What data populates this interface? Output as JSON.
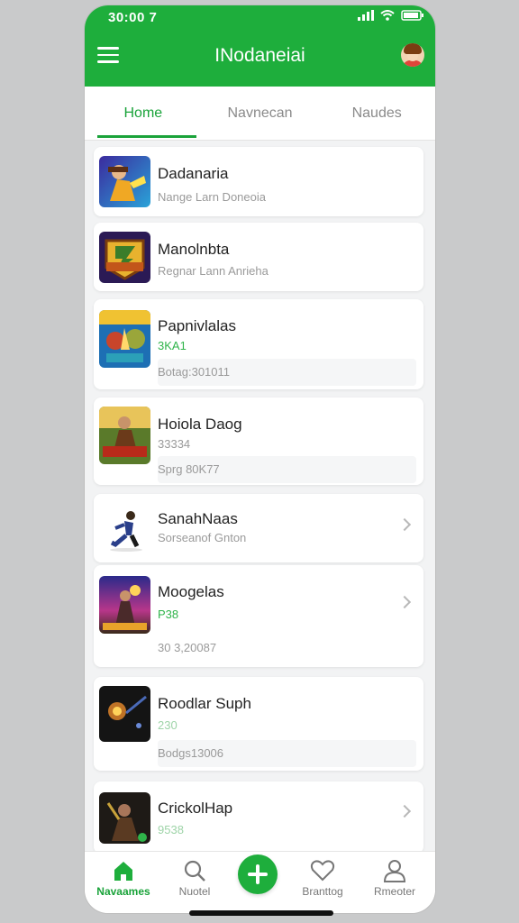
{
  "status_bar": {
    "time": "30:00 7"
  },
  "header": {
    "title": "INodaneiai"
  },
  "tabs": [
    {
      "label": "Home",
      "active": true
    },
    {
      "label": "Navnecan",
      "active": false
    },
    {
      "label": "Naudes",
      "active": false
    }
  ],
  "items": [
    {
      "name": "Dadanaria",
      "subtitle": "Nange Larn Doneoia",
      "icon": "game-art-hero-icon"
    },
    {
      "name": "Manolnbta",
      "subtitle": "Regnar Lann Anrieha",
      "icon": "game-art-badge-icon"
    },
    {
      "name": "Papnivlalas",
      "subtitle": "3KA1",
      "meta": "Botag:301011",
      "icon": "game-art-battle-icon"
    },
    {
      "name": "Hoiola Daog",
      "subtitle": "33334",
      "meta": "Sprg 80K77",
      "icon": "game-art-warrior-icon"
    },
    {
      "name": "SanahNaas",
      "subtitle": "Sorseanof Gnton",
      "icon": "runner-figure-icon"
    },
    {
      "name": "Moogelas",
      "subtitle": "P38",
      "meta": "30 3,20087",
      "icon": "game-art-fantasy-icon"
    },
    {
      "name": "Roodlar Suph",
      "subtitle": "230",
      "meta": "Bodgs13006",
      "icon": "game-art-space-icon"
    },
    {
      "name": "CrickolHap",
      "subtitle": "9538",
      "icon": "game-art-dark-icon"
    }
  ],
  "bottom_nav": [
    {
      "label": "Navaames",
      "icon": "home-icon",
      "active": true
    },
    {
      "label": "Nuotel",
      "icon": "search-icon",
      "active": false
    },
    {
      "label": "Branttog",
      "icon": "heart-icon",
      "active": false
    },
    {
      "label": "Rmeoter",
      "icon": "person-icon",
      "active": false
    }
  ],
  "colors": {
    "accent": "#1eae3c",
    "background": "#f2f3f4"
  }
}
